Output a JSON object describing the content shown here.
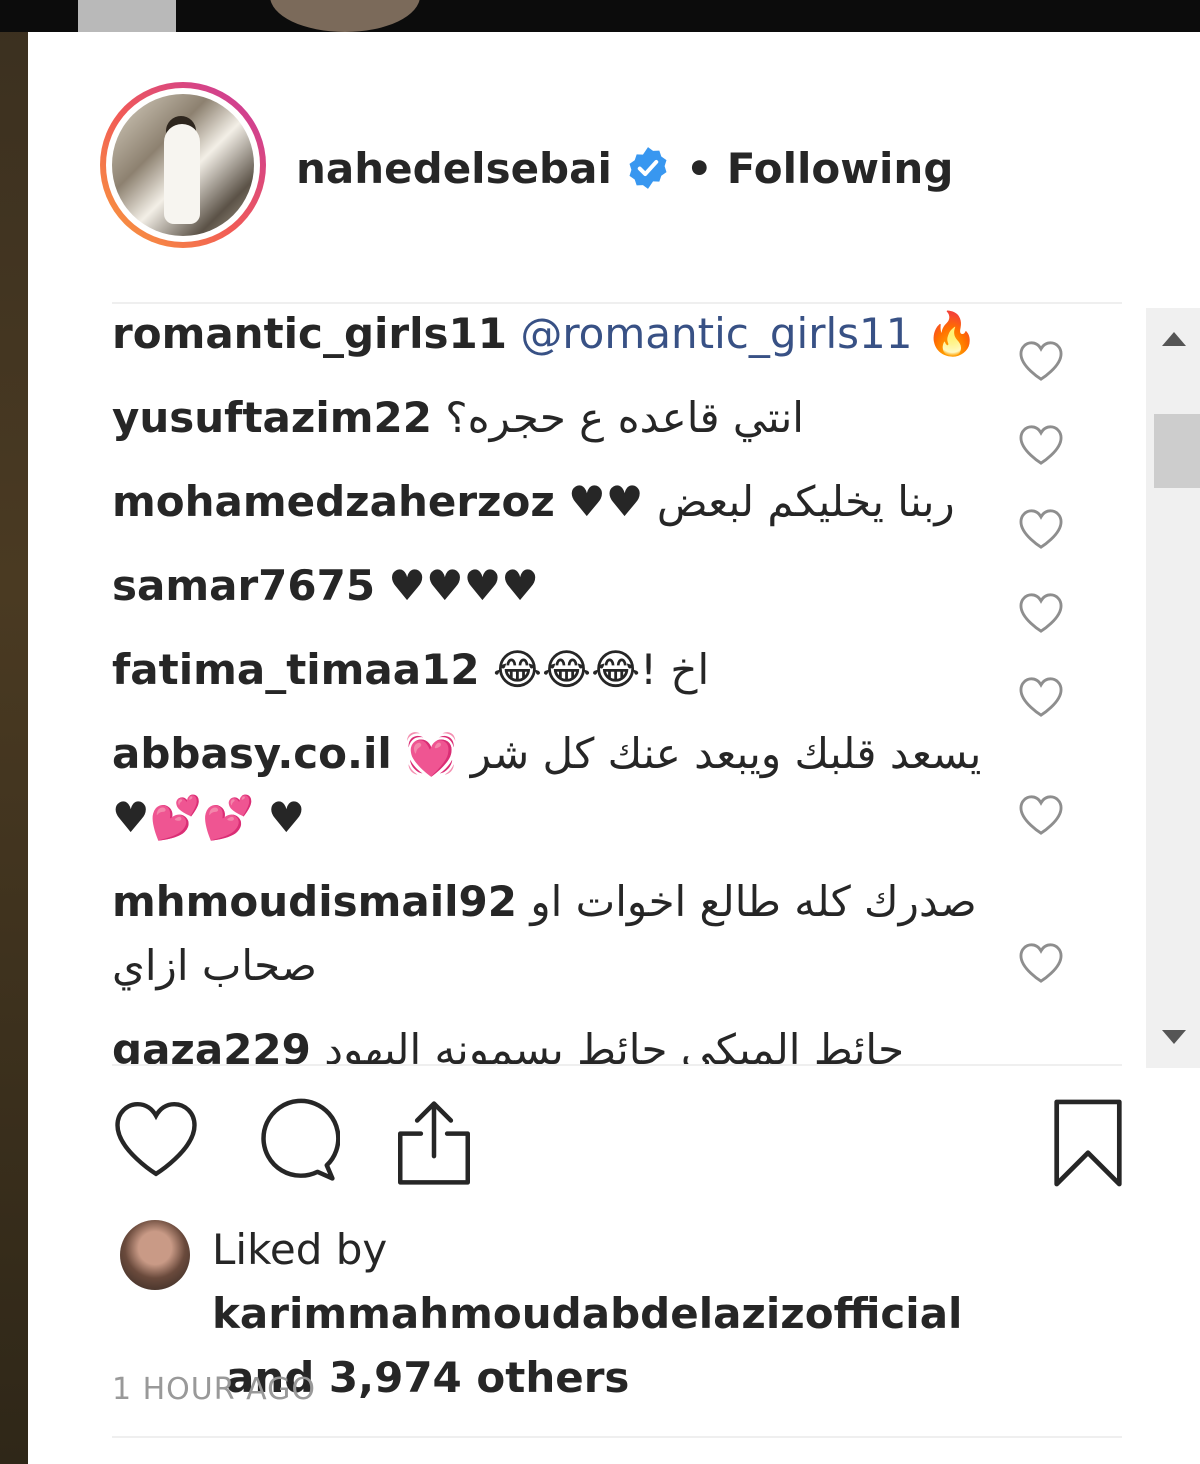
{
  "header": {
    "username": "nahedelsebai",
    "separator": "•",
    "follow_status": "Following"
  },
  "comments": [
    {
      "user": "romantic_girls11",
      "mention": "@romantic_girls11",
      "text": " 🔥"
    },
    {
      "user": "yusuftazim22",
      "mention": "",
      "text": " انتي قاعده ع حجره؟"
    },
    {
      "user": "mohamedzaherzoz",
      "mention": "",
      "text": " ربنا يخليكم لبعض ♥♥"
    },
    {
      "user": "samar7675",
      "mention": "",
      "text": " ♥♥♥♥"
    },
    {
      "user": "fatima_timaa12",
      "mention": "",
      "text": " اخ !😂😂😂"
    },
    {
      "user": "abbasy.co.il",
      "mention": "",
      "text": " يسعد قلبك ويبعد عنك كل شر 💓♥ 💕💕♥"
    },
    {
      "user": "mhmoudismail92",
      "mention": "",
      "text": " صدرك كله طالع اخوات او صحاب ازاي"
    },
    {
      "user": "gaza229",
      "mention": "",
      "text": " جائط المبكى جائط بسمونه اليهود عفوا"
    }
  ],
  "likes": {
    "prefix": "Liked by",
    "liker": "karimmahmoudabdelazizofficial",
    "rest": "and 3,974 others"
  },
  "timestamp": "1 HOUR AGO",
  "icons": {
    "verified": "verified-badge-icon",
    "like": "heart-icon",
    "comment": "comment-bubble-icon",
    "share": "share-icon",
    "save": "bookmark-icon",
    "comment_like": "heart-outline-icon"
  },
  "colors": {
    "verified": "#3897f0",
    "mention": "#385185",
    "text": "#262626",
    "muted": "#999999"
  }
}
